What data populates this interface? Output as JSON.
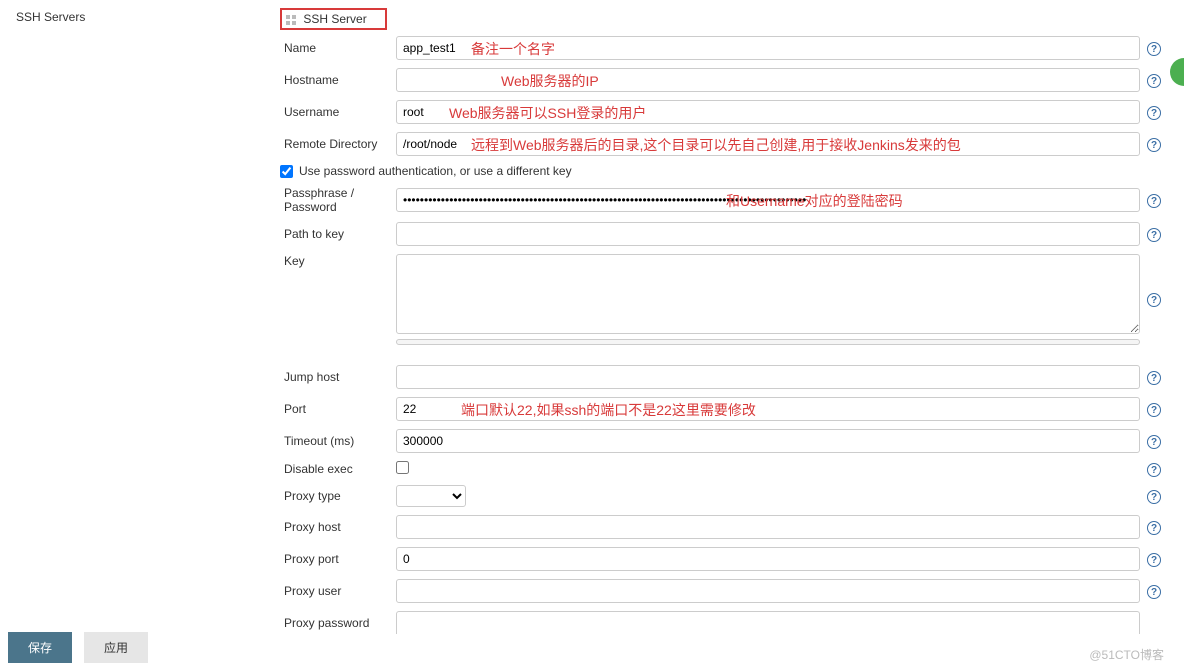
{
  "left": {
    "title": "SSH Servers"
  },
  "section_title": "SSH Server",
  "fields": {
    "name": {
      "label": "Name",
      "value": "app_test1"
    },
    "hostname": {
      "label": "Hostname",
      "value": ""
    },
    "username": {
      "label": "Username",
      "value": "root"
    },
    "remote_directory": {
      "label": "Remote Directory",
      "value": "/root/node"
    },
    "use_password_auth": {
      "label": "Use password authentication, or use a different key",
      "checked": true
    },
    "passphrase": {
      "label": "Passphrase / Password",
      "value": "••••••••••••••••••••••••••••••••••••••••••••••••••••••••••••••••••••••••••••••••••••••••••••••••"
    },
    "path_to_key": {
      "label": "Path to key",
      "value": ""
    },
    "key": {
      "label": "Key",
      "value": ""
    },
    "jump_host": {
      "label": "Jump host",
      "value": ""
    },
    "port": {
      "label": "Port",
      "value": "22"
    },
    "timeout": {
      "label": "Timeout (ms)",
      "value": "300000"
    },
    "disable_exec": {
      "label": "Disable exec",
      "checked": false
    },
    "proxy_type": {
      "label": "Proxy type",
      "value": ""
    },
    "proxy_host": {
      "label": "Proxy host",
      "value": ""
    },
    "proxy_port": {
      "label": "Proxy port",
      "value": "0"
    },
    "proxy_user": {
      "label": "Proxy user",
      "value": ""
    },
    "proxy_password": {
      "label": "Proxy password",
      "value": ""
    }
  },
  "annotations": {
    "name": "备注一个名字",
    "hostname": "Web服务器的IP",
    "username": "Web服务器可以SSH登录的用户",
    "remote_directory": "远程到Web服务器后的目录,这个目录可以先自己创建,用于接收Jenkins发来的包",
    "passphrase": "和Username对应的登陆密码",
    "port": "端口默认22,如果ssh的端口不是22这里需要修改"
  },
  "buttons": {
    "save": "保存",
    "apply": "应用"
  },
  "watermark": "@51CTO博客"
}
